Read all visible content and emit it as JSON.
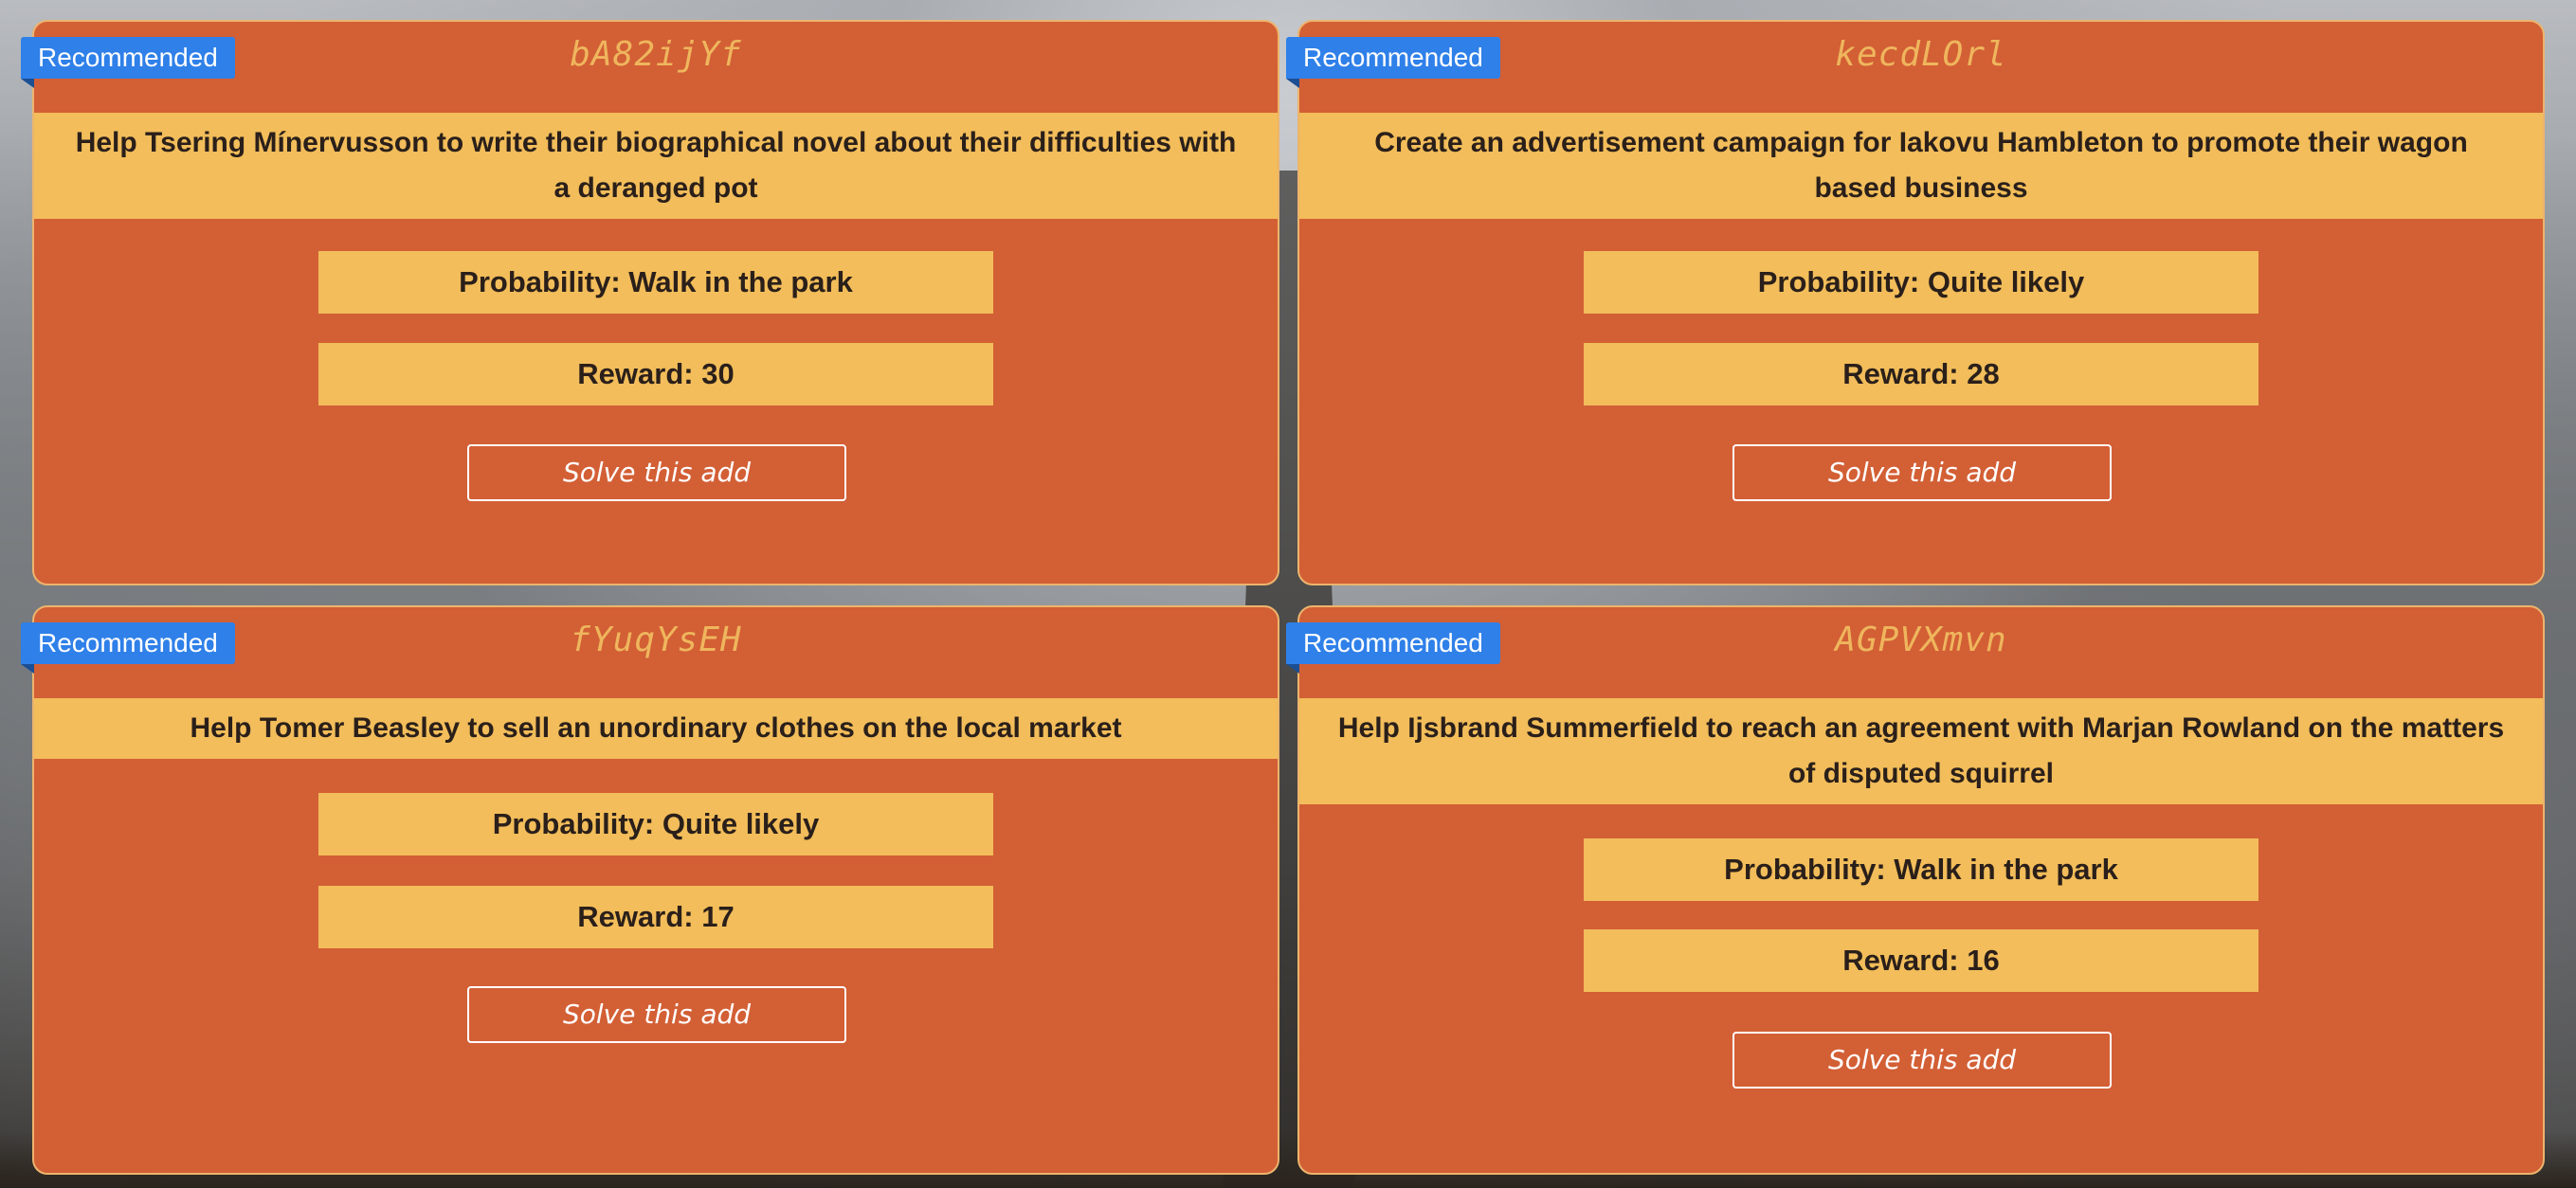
{
  "colors": {
    "card": "#d35f35",
    "card_border": "#ecb46d",
    "band": "#f2bd5a",
    "code_text": "#efb65d",
    "badge": "#2f80e9",
    "button_border": "#ffffff"
  },
  "cards": [
    {
      "badge": "Recommended",
      "code": "bA82ijYf",
      "description": "Help Tsering Mínervusson to write their biographical novel about their difficulties with a deranged pot",
      "probability_label": "Probability:",
      "probability_value": "Walk in the park",
      "reward_label": "Reward:",
      "reward_value": "30",
      "button_label": "Solve this add"
    },
    {
      "badge": "Recommended",
      "code": "kecdLOrl",
      "description": "Create an advertisement campaign for Iakovu Hambleton to promote their wagon based business",
      "probability_label": "Probability:",
      "probability_value": "Quite likely",
      "reward_label": "Reward:",
      "reward_value": "28",
      "button_label": "Solve this add"
    },
    {
      "badge": "Recommended",
      "code": "fYuqYsEH",
      "description": "Help Tomer Beasley to sell an unordinary clothes on the local market",
      "probability_label": "Probability:",
      "probability_value": "Quite likely",
      "reward_label": "Reward:",
      "reward_value": "17",
      "button_label": "Solve this add"
    },
    {
      "badge": "Recommended",
      "code": "AGPVXmvn",
      "description": "Help Ijsbrand Summerfield to reach an agreement with Marjan Rowland on the matters of disputed squirrel",
      "probability_label": "Probability:",
      "probability_value": "Walk in the park",
      "reward_label": "Reward:",
      "reward_value": "16",
      "button_label": "Solve this add"
    }
  ]
}
